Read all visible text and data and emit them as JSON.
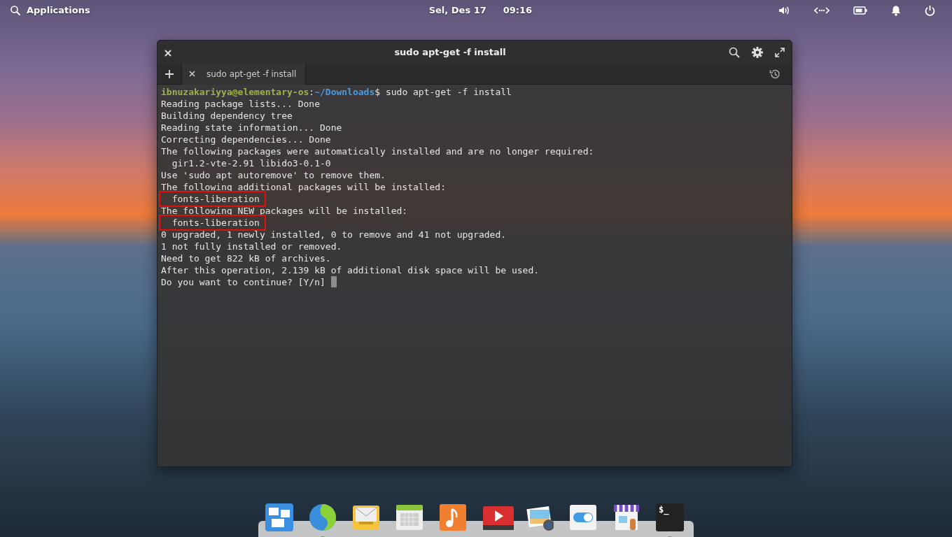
{
  "panel": {
    "applications": "Applications",
    "date": "Sel, Des 17",
    "time": "09:16"
  },
  "window": {
    "title": "sudo apt-get -f install"
  },
  "tabs": [
    {
      "label": "sudo apt-get -f install",
      "selected": true
    }
  ],
  "terminal": {
    "lines": [
      {
        "kind": "prompt",
        "user": "ibnuzakariyya@elementary-os",
        "sep": ":",
        "path": "~/Downloads",
        "command": "$ sudo apt-get -f install"
      },
      {
        "kind": "output",
        "text": "Reading package lists... Done",
        "highlighted": false
      },
      {
        "kind": "output",
        "text": "Building dependency tree",
        "highlighted": false
      },
      {
        "kind": "output",
        "text": "Reading state information... Done",
        "highlighted": false
      },
      {
        "kind": "output",
        "text": "Correcting dependencies... Done",
        "highlighted": false
      },
      {
        "kind": "output",
        "text": "The following packages were automatically installed and are no longer required:",
        "highlighted": false
      },
      {
        "kind": "output",
        "text": "  gir1.2-vte-2.91 libido3-0.1-0",
        "highlighted": false
      },
      {
        "kind": "output",
        "text": "Use 'sudo apt autoremove' to remove them.",
        "highlighted": false
      },
      {
        "kind": "output",
        "text": "The following additional packages will be installed:",
        "highlighted": false
      },
      {
        "kind": "output",
        "text": "  fonts-liberation",
        "highlighted": true
      },
      {
        "kind": "output",
        "text": "The following NEW packages will be installed:",
        "highlighted": false
      },
      {
        "kind": "output",
        "text": "  fonts-liberation",
        "highlighted": true
      },
      {
        "kind": "output",
        "text": "0 upgraded, 1 newly installed, 0 to remove and 41 not upgraded.",
        "highlighted": false
      },
      {
        "kind": "output",
        "text": "1 not fully installed or removed.",
        "highlighted": false
      },
      {
        "kind": "output",
        "text": "Need to get 822 kB of archives.",
        "highlighted": false
      },
      {
        "kind": "output",
        "text": "After this operation, 2.139 kB of additional disk space will be used.",
        "highlighted": false
      },
      {
        "kind": "input",
        "text": "Do you want to continue? [Y/n] "
      }
    ]
  },
  "dock": [
    {
      "kind": "multitasking",
      "running": false
    },
    {
      "kind": "browser",
      "running": true
    },
    {
      "kind": "mail",
      "running": false
    },
    {
      "kind": "calendar",
      "running": false
    },
    {
      "kind": "music",
      "running": false
    },
    {
      "kind": "video",
      "running": false
    },
    {
      "kind": "photos",
      "running": false
    },
    {
      "kind": "settings",
      "running": false
    },
    {
      "kind": "store",
      "running": false
    },
    {
      "kind": "terminal",
      "running": true,
      "text": "$_"
    }
  ]
}
